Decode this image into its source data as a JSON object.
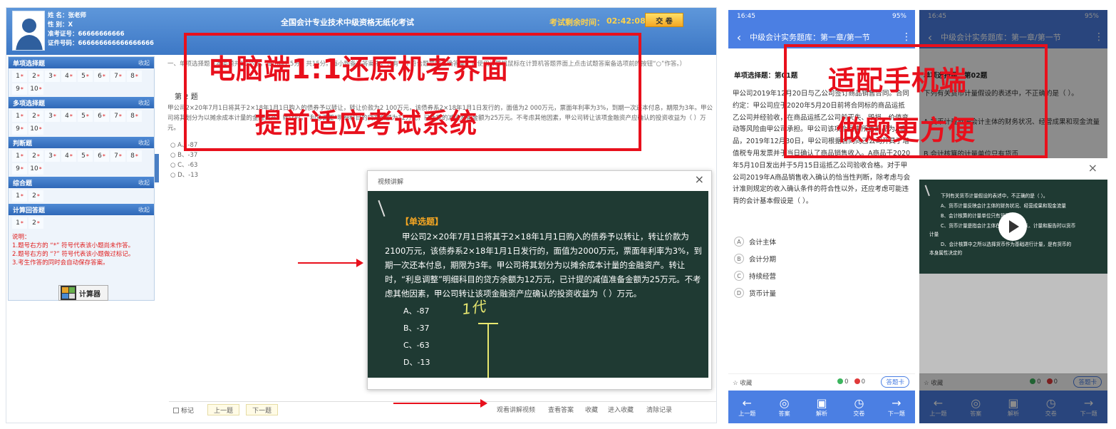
{
  "desktop": {
    "name_line": "姓 名：张老师",
    "gender_line": "性 别：X",
    "ticket_line": "准考证号：66666666666",
    "id_line": "证件号码：666666666666666666",
    "exam_title": "全国会计专业技术中级资格无纸化考试",
    "remaining_label": "考试剩余时间：",
    "timer": "02:42:08",
    "submit_label": "交 卷",
    "collapse_label": "收起",
    "sections": [
      {
        "title": "单项选择题",
        "questions": [
          "1",
          "2",
          "3",
          "4",
          "5",
          "6",
          "7",
          "8",
          "9",
          "10"
        ]
      },
      {
        "title": "多项选择题",
        "questions": [
          "1",
          "2",
          "3",
          "4",
          "5",
          "6",
          "7",
          "8",
          "9",
          "10"
        ]
      },
      {
        "title": "判断题",
        "questions": [
          "1",
          "2",
          "3",
          "4",
          "5",
          "6",
          "7",
          "8",
          "9",
          "10"
        ]
      },
      {
        "title": "综合题",
        "questions": [
          "1",
          "2"
        ]
      },
      {
        "title": "计算回答题",
        "questions": [
          "1",
          "2"
        ]
      }
    ],
    "star": "*",
    "note": [
      "说明：",
      "1.题号右方的 “*” 符号代表该小题尚未作答。",
      "2.题号右方的 “?” 符号代表该小题做过标记。",
      "3.考生作答的同时会自动保存答案。"
    ],
    "calculator_label": "计算器",
    "instruction": "一、单项选择题（本类题共10小题，每小题1.5分，共15分。每小题备选答案中，只有一个符合题意的正确答案。请使用计算机鼠标在计算机答题界面上点击试题答案备选项前的按钮“○”作答。）",
    "question_number": "第 2 题",
    "question_text": "甲公司2×20年7月1日将其于2×18年1月1日购入的债券予以转让，转让价款为2 100万元，该债券系2×18年1月1日发行的，面值为2 000万元，票面年利率为3%，到期一次还本付息，期限为3年。甲公司将其划分为以摊余成本计量的金融资产。转让时，“利息调整”明细科目的贷方余额为12万元，已计提的减值准备金额为25万元。不考虑其他因素，甲公司转让该项金融资产应确认的投资收益为（ ）万元。",
    "options": [
      "○ A、-87",
      "○ B、-37",
      "○ C、-63",
      "○ D、-13"
    ],
    "modal_title": "视频讲解",
    "board_tag": "【单选题】",
    "board_text": "甲公司2×20年7月1日将其于2×18年1月1日购入的债券予以转让，转让价款为2100万元，该债券系2×18年1月1日发行的，面值为2000万元，票面年利率为3%，到期一次还本付息，期限为3年。甲公司将其划分为以摊余成本计量的金融资产。转让时，“利息调整”明细科目的贷方余额为12万元，已计提的减值准备金额为25万元。不考虑其他因素，甲公司转让该项金融资产应确认的投资收益为（ ）万元。",
    "board_options": [
      "A、-87",
      "B、-37",
      "C、-63",
      "D、-13"
    ],
    "handwriting": "1代",
    "footer": {
      "mark": "标记",
      "prev": "上一题",
      "next": "下一题",
      "video": "观看讲解视频",
      "answer": "查看答案",
      "favorite": "收藏",
      "enter_favorites": "进入收藏",
      "clear": "清除记录"
    }
  },
  "overlay_desktop": [
    "电脑端1:1还原机考界面",
    "提前适应考试系统"
  ],
  "overlay_mobile": [
    "适配手机端",
    "做题更方便"
  ],
  "phone1": {
    "time": "16:45",
    "status_right": "95%",
    "title": "中级会计实务题库：第一章/第一节",
    "qtype": "单项选择题：第01题",
    "question": "甲公司2019年12月20日与乙公司签订商品销售合同。合同约定：甲公司应于2020年5月20日前将合同标的商品运抵乙公司并经验收，在商品运抵乙公司前灭失、毁损、价值变动等风险由甲公司承担。甲公司该项合同中所售商品为A商品，2019年12月30日，甲公司根据合同向乙公司开具了增值税专用发票并于当日确认了商品销售收入。A商品于2020年5月10日发出并于5月15日运抵乙公司验收合格。对于甲公司2019年A商品销售收入确认的恰当性判断，除考虑与会计准则规定的收入确认条件的符合性以外，还应考虑可能违背的会计基本假设是（ ）。",
    "options": [
      {
        "key": "A",
        "text": "会计主体"
      },
      {
        "key": "B",
        "text": "会计分期"
      },
      {
        "key": "C",
        "text": "持续经营"
      },
      {
        "key": "D",
        "text": "货币计量"
      }
    ],
    "favorite": "收藏",
    "correct": "0",
    "wrong": "0",
    "card": "答题卡",
    "nav": [
      {
        "icon": "←",
        "label": "上一题"
      },
      {
        "icon": "◎",
        "label": "答案"
      },
      {
        "icon": "▣",
        "label": "解析"
      },
      {
        "icon": "◷",
        "label": "交卷"
      },
      {
        "icon": "→",
        "label": "下一题"
      }
    ]
  },
  "phone2": {
    "time": "16:45",
    "status_right": "95%",
    "title": "中级会计实务题库：第一章/第一节",
    "qtype": "单项选择题：第02题",
    "question": "下列有关货币计量假设的表述中，不正确的是（ ）。",
    "option_a": "A  货币计量反映会计主体的财务状况、经营成果和现金流量",
    "option_b": "B  会计核算的计量单位只有货币",
    "board_lines": [
      "下列有关货币计量假设的表述中，不正确的是（ ）。",
      "A、货币计量反映会计主体的财务状况、经营成果和现金流量",
      "B、会计核算的计量单位只有货币",
      "C、货币计量是指会计主体在进行会计确认、计量和报告时以货币",
      "计量",
      "D、会计核算中之所以选择货币作为基础进行计量，是有货币的",
      "本身属性决定的"
    ],
    "favorite": "收藏",
    "correct": "0",
    "wrong": "0",
    "card": "答题卡",
    "nav": [
      {
        "icon": "←",
        "label": "上一题"
      },
      {
        "icon": "◎",
        "label": "答案"
      },
      {
        "icon": "▣",
        "label": "解析"
      },
      {
        "icon": "◷",
        "label": "交卷"
      },
      {
        "icon": "→",
        "label": "下一题"
      }
    ]
  },
  "colors": {
    "accent_blue": "#4b7fe3",
    "overlay_red": "#e8101c",
    "board_green": "#1f3a33",
    "timer_yellow": "#ffd24a"
  }
}
